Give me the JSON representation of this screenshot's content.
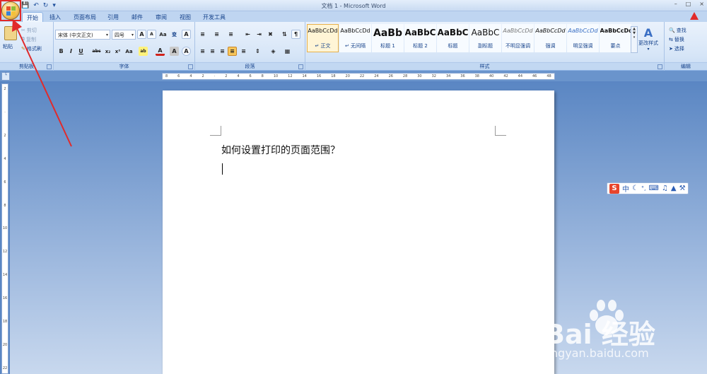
{
  "window": {
    "title": "文档 1 - Microsoft Word",
    "controls": [
      "–",
      "□",
      "×"
    ]
  },
  "quick_access": [
    "save-icon",
    "undo-icon",
    "redo-icon",
    "customize-icon"
  ],
  "tabs": [
    {
      "label": "开始",
      "active": true
    },
    {
      "label": "插入"
    },
    {
      "label": "页面布局"
    },
    {
      "label": "引用"
    },
    {
      "label": "邮件"
    },
    {
      "label": "审阅"
    },
    {
      "label": "视图"
    },
    {
      "label": "开发工具"
    }
  ],
  "clipboard": {
    "label": "剪贴板",
    "paste": "粘贴",
    "cut": "剪切",
    "copy": "复制",
    "format_painter": "格式刷"
  },
  "font": {
    "label": "字体",
    "font_name": "宋体 (中文正文)",
    "font_size": "四号",
    "buttons_row1": [
      "A",
      "A",
      "Aa",
      "A"
    ],
    "buttons_row2": [
      "B",
      "I",
      "U",
      "abc",
      "x₂",
      "x²",
      "Aa",
      "ab",
      "A",
      "A",
      "A"
    ]
  },
  "paragraph": {
    "label": "段落"
  },
  "styles": {
    "label": "样式",
    "items": [
      {
        "sample": "AaBbCcDd",
        "name": "↵ 正文",
        "selected": true
      },
      {
        "sample": "AaBbCcDd",
        "name": "↵ 无间隔"
      },
      {
        "sample": "AaBb",
        "name": "标题 1"
      },
      {
        "sample": "AaBbC",
        "name": "标题 2"
      },
      {
        "sample": "AaBbC",
        "name": "标题"
      },
      {
        "sample": "AaBbC",
        "name": "副标题"
      },
      {
        "sample": "AaBbCcDd",
        "name": "不明显强调"
      },
      {
        "sample": "AaBbCcDd",
        "name": "强调"
      },
      {
        "sample": "AaBbCcDd",
        "name": "明显强调"
      },
      {
        "sample": "AaBbCcDd",
        "name": "要点"
      }
    ],
    "change_styles": "更改样式"
  },
  "editing": {
    "label": "编辑",
    "find": "查找",
    "replace": "替换",
    "select": "选择"
  },
  "ruler": {
    "h_ticks": [
      "8",
      "6",
      "4",
      "2",
      "",
      "2",
      "4",
      "6",
      "8",
      "10",
      "12",
      "14",
      "16",
      "18",
      "20",
      "22",
      "24",
      "26",
      "28",
      "30",
      "32",
      "34",
      "36",
      "38",
      "40",
      "42",
      "44",
      "46",
      "48"
    ],
    "v_ticks": [
      "2",
      "",
      "2",
      "4",
      "6",
      "8",
      "10",
      "12",
      "14",
      "16",
      "18",
      "20",
      "22"
    ]
  },
  "document": {
    "text": "如何设置打印的页面范围？"
  },
  "ime": {
    "logo": "S",
    "mode": "中"
  },
  "watermark": {
    "brand": "Bai  经验",
    "url": "jingyan.baidu.com"
  },
  "colors": {
    "annotation": "#e12a2a",
    "ribbon_text": "#15428b",
    "background": "#5a86c3"
  }
}
